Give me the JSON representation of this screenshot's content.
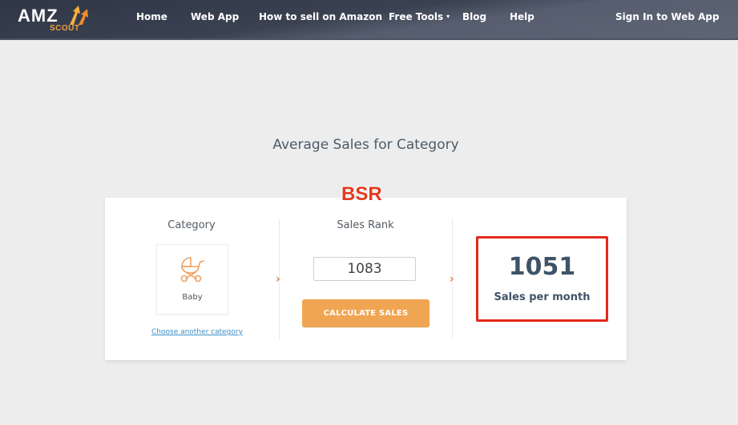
{
  "navbar": {
    "logo": {
      "primary": "AMZ",
      "secondary": "SCOUT"
    },
    "items": [
      {
        "label": "Home"
      },
      {
        "label": "Web App"
      },
      {
        "label": "How to sell on Amazon"
      },
      {
        "label": "Free Tools",
        "has_dropdown": true
      },
      {
        "label": "Blog"
      },
      {
        "label": "Help"
      }
    ],
    "sign_in": "Sign In to Web App",
    "caret": "▾"
  },
  "page": {
    "title": "Average Sales for Category",
    "annotation": "BSR"
  },
  "calculator": {
    "category": {
      "title": "Category",
      "selected": "Baby",
      "icon": "baby-stroller-icon",
      "change_link": "Choose another category"
    },
    "sales_rank": {
      "title": "Sales Rank",
      "value": "1083",
      "button_label": "CALCULATE SALES"
    },
    "result": {
      "value": "1051",
      "label": "Sales per month"
    },
    "step_arrow": "›"
  },
  "colors": {
    "accent_orange": "#f0a553",
    "arrow_orange": "#e8813a",
    "highlight_red": "#e3281b",
    "link_blue": "#3b8fc6",
    "title_text": "#4d5a66"
  }
}
